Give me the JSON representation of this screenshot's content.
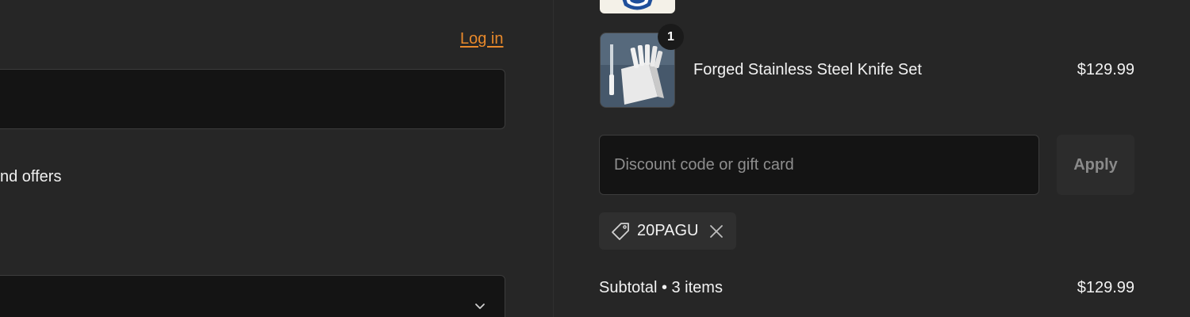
{
  "contact": {
    "login_link": "Log in",
    "offers_label": "nd offers"
  },
  "cart": {
    "items": [
      {
        "name": "Forged Stainless Steel Knife Set",
        "price": "$129.99",
        "quantity": "1",
        "thumbnail": "knife-block-image"
      }
    ]
  },
  "discount": {
    "placeholder": "Discount code or gift card",
    "apply_label": "Apply",
    "applied_code": "20PAGU"
  },
  "summary": {
    "subtotal_label": "Subtotal • 3 items",
    "subtotal_value": "$129.99"
  },
  "colors": {
    "background": "#262626",
    "input_background": "#141414",
    "link_accent": "#e8892b",
    "apply_text": "#8a8a8a"
  }
}
